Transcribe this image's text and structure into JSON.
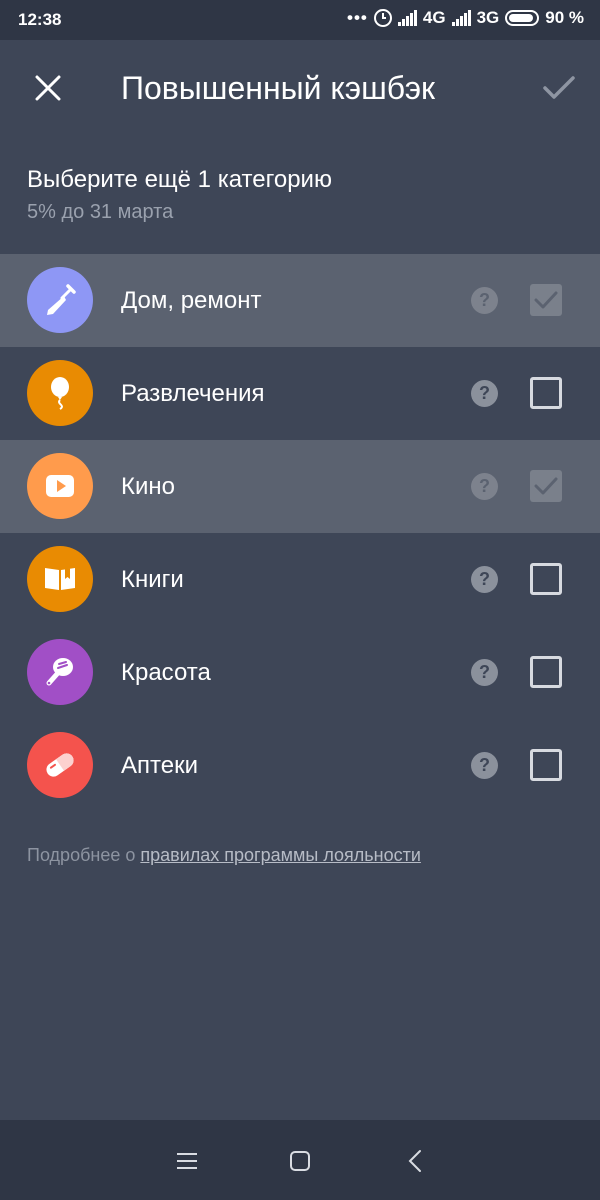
{
  "status_bar": {
    "time": "12:38",
    "network_1": "4G",
    "network_2": "3G",
    "battery": "90 %"
  },
  "header": {
    "title": "Повышенный кэшбэк",
    "close_icon": "close-icon",
    "confirm_icon": "check-icon"
  },
  "selection": {
    "heading": "Выберите ещё 1 категорию",
    "subheading": "5% до 31 марта"
  },
  "categories": [
    {
      "label": "Дом, ремонт",
      "icon": "trowel-icon",
      "color": "#8e97f5",
      "checked": true
    },
    {
      "label": "Развлечения",
      "icon": "balloon-icon",
      "color": "#e98b02",
      "checked": false
    },
    {
      "label": "Кино",
      "icon": "play-icon",
      "color": "#ff9b4c",
      "checked": true
    },
    {
      "label": "Книги",
      "icon": "book-icon",
      "color": "#e98b02",
      "checked": false
    },
    {
      "label": "Красота",
      "icon": "mirror-icon",
      "color": "#a14fc6",
      "checked": false
    },
    {
      "label": "Аптеки",
      "icon": "pill-icon",
      "color": "#f4534d",
      "checked": false
    }
  ],
  "help_symbol": "?",
  "footer": {
    "prefix": "Подробнее о ",
    "link": "правилах программы лояльности"
  },
  "colors": {
    "background": "#3e4657",
    "selected_row": "#5b6270"
  }
}
